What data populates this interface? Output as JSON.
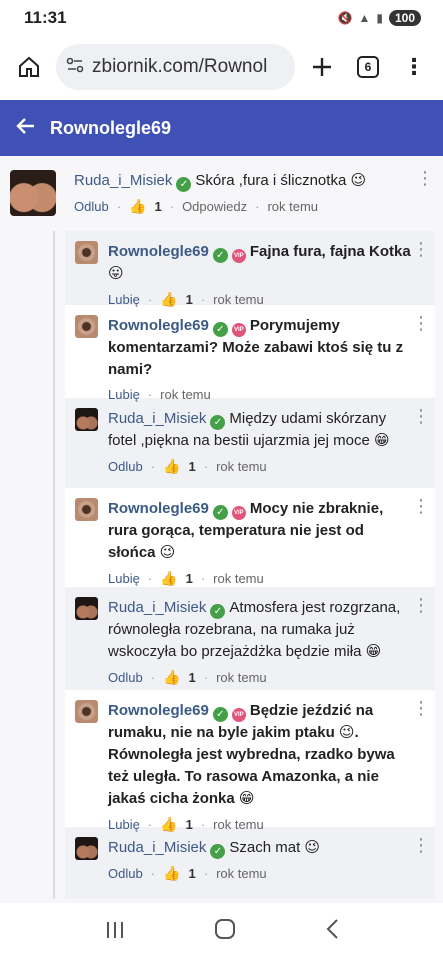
{
  "status": {
    "time": "11:31",
    "battery": "100"
  },
  "browser": {
    "url": "zbiornik.com/Rownol",
    "tab_count": "6"
  },
  "header": {
    "title": "Rownolegle69"
  },
  "root_comment": {
    "author": "Ruda_i_Misiek",
    "text": "Skóra ,fura i ślicznotka 😉",
    "action": "Odlub",
    "likes": "1",
    "reply": "Odpowiedz",
    "time": "rok temu"
  },
  "replies": [
    {
      "author": "Rownolegle69",
      "text": "Fajna fura, fajna Kotka 😛",
      "action": "Lubię",
      "likes": "1",
      "time": "rok temu"
    },
    {
      "author": "Rownolegle69",
      "text": "Porymujemy komentarzami? Może zabawi ktoś się tu z nami?",
      "action": "Lubię",
      "likes": "",
      "time": "rok temu"
    },
    {
      "author": "Ruda_i_Misiek",
      "text": "Między udami skórzany fotel ,piękna na bestii ujarzmia jej moce 😁",
      "action": "Odlub",
      "likes": "1",
      "time": "rok temu"
    },
    {
      "author": "Rownolegle69",
      "text": "Mocy nie zbraknie, rura gorąca, temperatura nie jest od słońca 😉",
      "action": "Lubię",
      "likes": "1",
      "time": "rok temu"
    },
    {
      "author": "Ruda_i_Misiek",
      "text": "Atmosfera jest rozgrzana, równoległa rozebrana, na rumaka już wskoczyła bo przejażdżka będzie miła 😁",
      "action": "Odlub",
      "likes": "1",
      "time": "rok temu"
    },
    {
      "author": "Rownolegle69",
      "text": "Będzie jeździć na rumaku, nie na byle jakim ptaku 😉. Równoległa jest wybredna, rzadko bywa też uległa. To rasowa Amazonka, a nie jakaś cicha żonka 😁",
      "action": "Lubię",
      "likes": "1",
      "time": "rok temu"
    },
    {
      "author": "Ruda_i_Misiek",
      "text": "Szach mat 😉",
      "action": "Odlub",
      "likes": "1",
      "time": "rok temu"
    }
  ],
  "labels": {
    "vip": "VIP",
    "verified": "✓"
  }
}
